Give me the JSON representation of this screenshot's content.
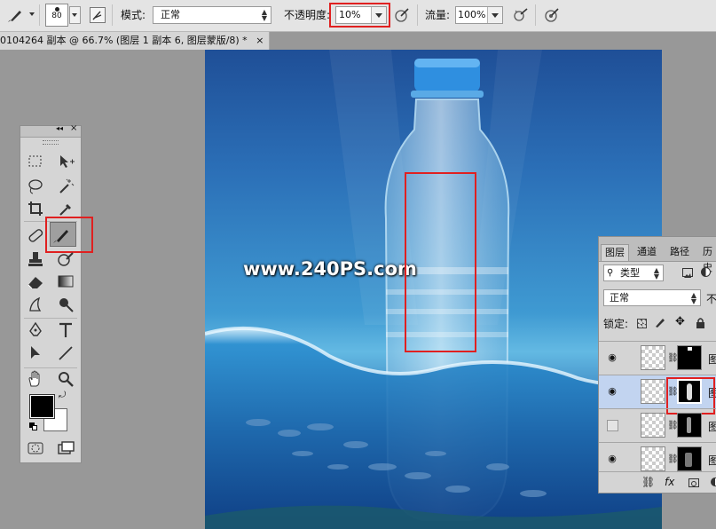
{
  "options_bar": {
    "brush_size": "80",
    "mode_label": "模式:",
    "mode_value": "正常",
    "opacity_label": "不透明度:",
    "opacity_value": "10%",
    "flow_label": "流量:",
    "flow_value": "100%"
  },
  "document": {
    "tab_title": "0104264 副本 @ 66.7% (图层 1 副本 6, 图层蒙版/8) *",
    "close": "×",
    "watermark": "www.240PS.com"
  },
  "tools_panel": {
    "collapse_glyph": "◂◂",
    "close_glyph": "×"
  },
  "layers_panel": {
    "tabs": [
      "图层",
      "通道",
      "路径",
      "历史"
    ],
    "filter_label": "类型",
    "blend_mode": "正常",
    "opacity_short": "不",
    "lock_label": "锁定:",
    "layer_name_stub": "图",
    "footer_fx": "fx"
  },
  "colors": {
    "highlight": "#e02020",
    "selected_layer": "#c2d4f0",
    "foreground": "#000000",
    "background": "#ffffff"
  }
}
